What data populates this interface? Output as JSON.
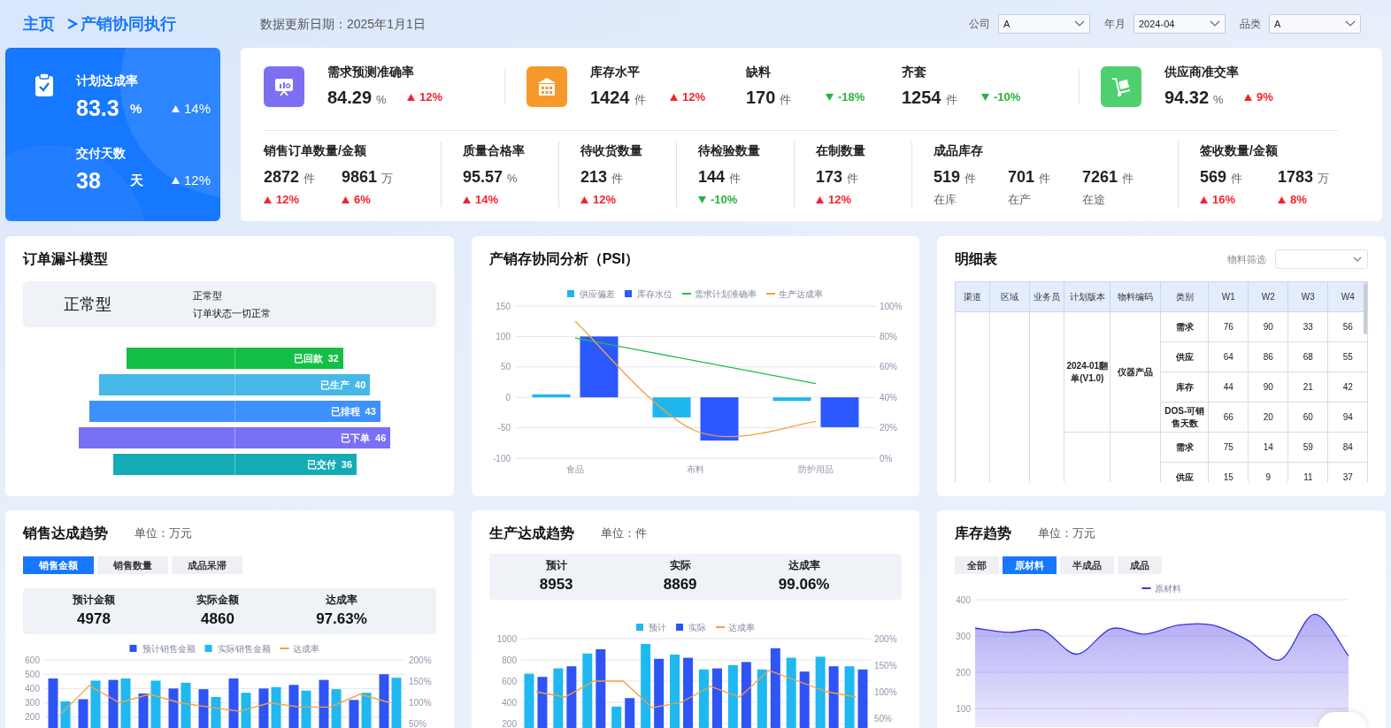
{
  "breadcrumb": [
    "主页",
    "产销协同执行"
  ],
  "update_date": "数据更新日期：2025年1月1日",
  "filters": [
    {
      "label": "公司",
      "value": "A"
    },
    {
      "label": "年月",
      "value": "2024-04"
    },
    {
      "label": "品类",
      "value": "A"
    }
  ],
  "highlights": [
    {
      "label": "计划达成率",
      "value": "83.3",
      "unit": "%",
      "change": "14%",
      "rising": true
    },
    {
      "label": "交付天数",
      "value": "38",
      "unit": "天",
      "change": "12%",
      "rising": true
    }
  ],
  "kpi_groups": [
    {
      "kind": "forecast",
      "metrics": [
        {
          "label": "需求预测准确率",
          "value": "84.29",
          "unit": "%",
          "change": "12%",
          "rising": true
        }
      ]
    },
    {
      "kind": "inventory",
      "metrics": [
        {
          "label": "库存水平",
          "value": "1424",
          "unit": "件",
          "change": "12%",
          "rising": true
        },
        {
          "label": "缺料",
          "value": "170",
          "unit": "件",
          "change": "-18%",
          "rising": false
        },
        {
          "label": "齐套",
          "value": "1254",
          "unit": "件",
          "change": "-10%",
          "rising": false
        }
      ]
    },
    {
      "kind": "supplier",
      "metrics": [
        {
          "label": "供应商准交率",
          "value": "94.32",
          "unit": "%",
          "change": "9%",
          "rising": true
        }
      ]
    }
  ],
  "details": [
    {
      "title": "销售订单数量/金额",
      "values": [
        {
          "value": "2872",
          "unit": "件",
          "change": "12%",
          "rising": true
        },
        {
          "value": "9861",
          "unit": "万",
          "change": "6%",
          "rising": true
        }
      ]
    },
    {
      "title": "质量合格率",
      "values": [
        {
          "value": "95.57",
          "unit": "%",
          "change": "14%",
          "rising": true
        }
      ]
    },
    {
      "title": "待收货数量",
      "values": [
        {
          "value": "213",
          "unit": "件",
          "change": "12%",
          "rising": true
        }
      ]
    },
    {
      "title": "待检验数量",
      "values": [
        {
          "value": "144",
          "unit": "件",
          "change": "-10%",
          "rising": false
        }
      ]
    },
    {
      "title": "在制数量",
      "values": [
        {
          "value": "173",
          "unit": "件",
          "change": "12%",
          "rising": true
        }
      ]
    },
    {
      "title": "成品库存",
      "values": [
        {
          "value": "519",
          "unit": "件",
          "caption": "在库"
        },
        {
          "value": "701",
          "unit": "件",
          "caption": "在产"
        },
        {
          "value": "7261",
          "unit": "件",
          "caption": "在途"
        }
      ]
    },
    {
      "title": "签收数量/金额",
      "values": [
        {
          "value": "569",
          "unit": "件",
          "change": "16%",
          "rising": true
        },
        {
          "value": "1783",
          "unit": "万",
          "change": "8%",
          "rising": true
        }
      ]
    }
  ],
  "funnel": {
    "title": "订单漏斗模型",
    "status_title": "正常型",
    "status_lines": [
      "正常型",
      "订单状态一切正常"
    ],
    "stages": [
      {
        "label": "已回款",
        "value": "32",
        "color": "#13c045"
      },
      {
        "label": "已生产",
        "value": "40",
        "color": "#45b8e8"
      },
      {
        "label": "已排程",
        "value": "43",
        "color": "#3c91fd"
      },
      {
        "label": "已下单",
        "value": "46",
        "color": "#7a70f5"
      },
      {
        "label": "已交付",
        "value": "36",
        "color": "#14abb5"
      }
    ]
  },
  "psi": {
    "title": "产销存协同分析（PSI）",
    "chart_data": {
      "type": "bar",
      "stacked": false,
      "grid": true,
      "legend": true,
      "categories": [
        "食品",
        "布料",
        "防护用品"
      ],
      "ylim": [
        -100,
        150
      ],
      "yticks": [
        -100,
        -50,
        0,
        50,
        100,
        150
      ],
      "y2lim": [
        0,
        100
      ],
      "y2ticks": [
        {
          "value": 0,
          "label": "0%"
        },
        {
          "value": 20,
          "label": "20%"
        },
        {
          "value": 40,
          "label": "40%"
        },
        {
          "value": 60,
          "label": "60%"
        },
        {
          "value": 80,
          "label": "80%"
        },
        {
          "value": 100,
          "label": "100%"
        }
      ],
      "series": [
        {
          "name": "供应偏差",
          "type": "bar",
          "color": "#1fb6f0",
          "values": [
            5,
            -33,
            -6
          ]
        },
        {
          "name": "库存水位",
          "type": "bar",
          "color": "#2b59ff",
          "values": [
            100,
            -71,
            -49
          ]
        },
        {
          "name": "需求计划准确率",
          "type": "line",
          "axis": "y2",
          "color": "#1fbe47",
          "values": [
            79,
            64,
            49
          ]
        },
        {
          "name": "生产达成率",
          "type": "line",
          "axis": "y2",
          "color": "#f5a042",
          "values": [
            90,
            18,
            24
          ]
        }
      ]
    }
  },
  "detail_table": {
    "title": "明细表",
    "filter_label": "物料筛选",
    "columns": [
      "渠道",
      "区域",
      "业务员",
      "计划版本",
      "物料编码",
      "类别",
      "W1",
      "W2",
      "W3",
      "W4"
    ],
    "groups": [
      {
        "plan_version": "2024-01翻单(V1.0)",
        "material": "仪器产品",
        "rows": [
          {
            "category": "需求",
            "values": [
              "76",
              "90",
              "33",
              "56"
            ]
          },
          {
            "category": "供应",
            "values": [
              "64",
              "86",
              "68",
              "55"
            ]
          },
          {
            "category": "库存",
            "values": [
              "44",
              "90",
              "21",
              "42"
            ]
          },
          {
            "category": "DOS-可销售天数",
            "values": [
              "66",
              "20",
              "60",
              "94"
            ]
          }
        ]
      },
      {
        "rows": [
          {
            "category": "需求",
            "values": [
              "75",
              "14",
              "59",
              "84"
            ]
          },
          {
            "category": "供应",
            "values": [
              "15",
              "9",
              "11",
              "37"
            ]
          }
        ]
      }
    ]
  },
  "sales": {
    "title": "销售达成趋势",
    "unit": "单位：万元",
    "tabs": [
      {
        "label": "销售金额",
        "selected": true
      },
      {
        "label": "销售数量",
        "selected": false
      },
      {
        "label": "成品呆滞",
        "selected": false
      }
    ],
    "summary": [
      {
        "label": "预计金额",
        "value": "4978"
      },
      {
        "label": "实际金额",
        "value": "4860"
      },
      {
        "label": "达成率",
        "value": "97.63%"
      }
    ],
    "chart_data": {
      "type": "bar",
      "stacked": false,
      "grid": true,
      "legend": true,
      "ylim": [
        0,
        600
      ],
      "yticks": [
        200,
        300,
        400,
        500,
        600
      ],
      "y2lim": [
        0,
        200
      ],
      "y2ticks": [
        {
          "value": 50,
          "label": "50%"
        },
        {
          "value": 100,
          "label": "100%"
        },
        {
          "value": 150,
          "label": "150%"
        },
        {
          "value": 200,
          "label": "200%"
        }
      ],
      "series": [
        {
          "name": "预计销售金额",
          "type": "bar",
          "color": "#2f54f5",
          "values": [
            470,
            325,
            460,
            365,
            400,
            395,
            470,
            400,
            425,
            460,
            320,
            500
          ]
        },
        {
          "name": "实际销售金额",
          "type": "bar",
          "color": "#1fb8f0",
          "values": [
            310,
            455,
            470,
            455,
            440,
            340,
            370,
            410,
            385,
            395,
            370,
            475
          ]
        },
        {
          "name": "达成率",
          "type": "line",
          "axis": "y2",
          "color": "#f5a042",
          "values": [
            70,
            140,
            100,
            120,
            100,
            90,
            80,
            100,
            90,
            90,
            120,
            100
          ]
        }
      ]
    }
  },
  "production": {
    "title": "生产达成趋势",
    "unit": "单位：件",
    "summary": [
      {
        "label": "预计",
        "value": "8953"
      },
      {
        "label": "实际",
        "value": "8869"
      },
      {
        "label": "达成率",
        "value": "99.06%"
      }
    ],
    "chart_data": {
      "type": "bar",
      "stacked": false,
      "grid": true,
      "legend": true,
      "ylim": [
        0,
        1000
      ],
      "yticks": [
        200,
        400,
        600,
        800,
        1000
      ],
      "y2lim": [
        0,
        200
      ],
      "y2ticks": [
        {
          "value": 50,
          "label": "50%"
        },
        {
          "value": 100,
          "label": "100%"
        },
        {
          "value": 150,
          "label": "150%"
        },
        {
          "value": 200,
          "label": "200%"
        }
      ],
      "series": [
        {
          "name": "预计",
          "type": "bar",
          "color": "#1fb8f0",
          "values": [
            670,
            720,
            860,
            360,
            950,
            850,
            710,
            750,
            710,
            820,
            830,
            740
          ]
        },
        {
          "name": "实际",
          "type": "bar",
          "color": "#2f54f5",
          "values": [
            640,
            740,
            900,
            440,
            810,
            820,
            720,
            780,
            910,
            690,
            740,
            710
          ]
        },
        {
          "name": "达成率",
          "type": "line",
          "axis": "y2",
          "color": "#f5a042",
          "values": [
            100,
            90,
            120,
            120,
            70,
            80,
            110,
            90,
            140,
            120,
            100,
            90
          ]
        }
      ]
    }
  },
  "inventory": {
    "title": "库存趋势",
    "unit": "单位：万元",
    "tabs": [
      {
        "label": "全部",
        "selected": false
      },
      {
        "label": "原材料",
        "selected": true
      },
      {
        "label": "半成品",
        "selected": false
      },
      {
        "label": "成品",
        "selected": false
      }
    ],
    "chart_data": {
      "type": "area",
      "grid": true,
      "legend": true,
      "ylim": [
        0,
        400
      ],
      "yticks": [
        100,
        200,
        300,
        400
      ],
      "series": [
        {
          "name": "原材料",
          "type": "area",
          "color": "#3b2ee6",
          "values": [
            322,
            310,
            315,
            250,
            320,
            305,
            330,
            330,
            290,
            235,
            360,
            245
          ]
        }
      ]
    }
  }
}
